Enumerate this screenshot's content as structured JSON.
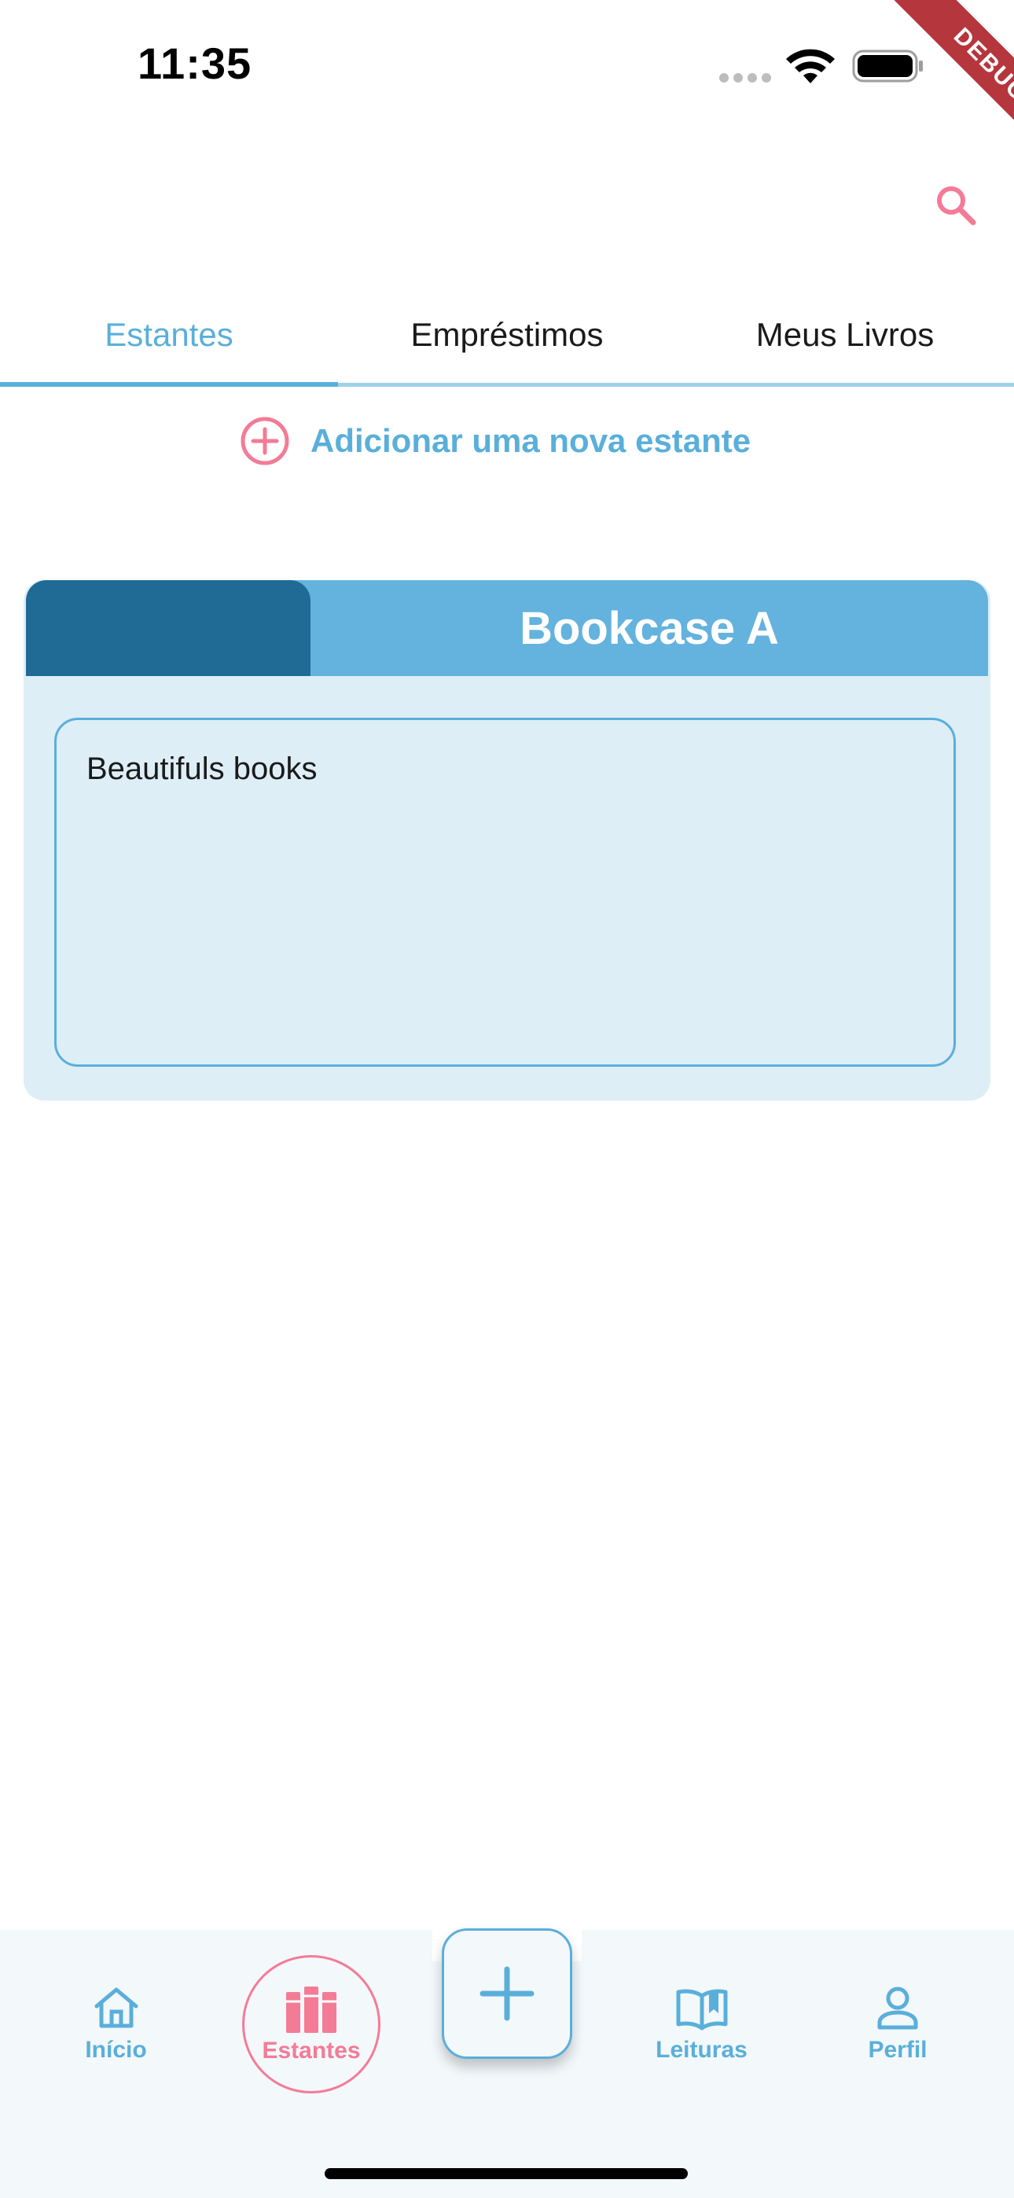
{
  "status_bar": {
    "time": "11:35"
  },
  "debug_banner": "DEBUG",
  "app_bar": {
    "search_icon": "search-icon"
  },
  "tabs": [
    {
      "label": "Estantes",
      "active": true
    },
    {
      "label": "Empréstimos",
      "active": false
    },
    {
      "label": "Meus Livros",
      "active": false
    }
  ],
  "add_shelf": {
    "label": "Adicionar uma nova estante",
    "icon": "add-circle-icon"
  },
  "bookcase": {
    "title": "Bookcase A",
    "description": "Beautifuls books"
  },
  "bottom_nav": {
    "items": [
      {
        "label": "Início",
        "icon": "home-icon"
      },
      {
        "label": "Estantes",
        "icon": "bookshelf-icon",
        "active": true
      },
      {
        "label": "Leituras",
        "icon": "open-book-icon"
      },
      {
        "label": "Perfil",
        "icon": "person-icon"
      }
    ],
    "fab_icon": "plus-icon"
  },
  "colors": {
    "primary": "#5aafda",
    "primary_dark": "#206a96",
    "accent_pink": "#f47b96",
    "card_background": "#deeef7",
    "nav_background": "#f3f8fb"
  }
}
